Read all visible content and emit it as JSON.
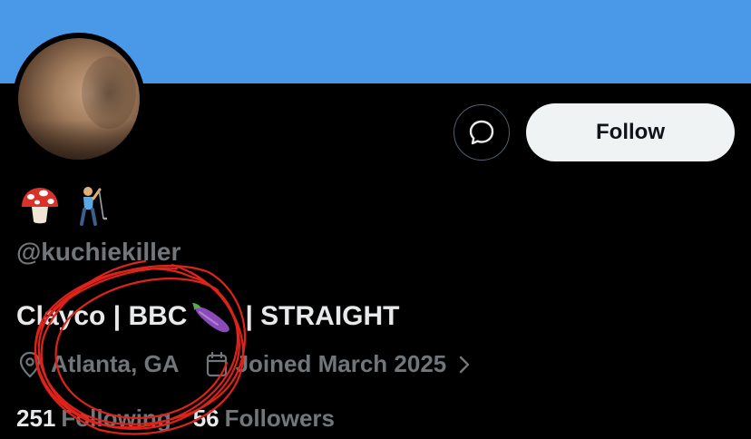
{
  "profile": {
    "handle": "@kuchiekiller",
    "bio_main": "Clayco | BBC",
    "bio_end": " | STRAIGHT",
    "location": "Atlanta, GA",
    "joined": "Joined March 2025",
    "following_count": "251",
    "following_label": "Following",
    "followers_count": "56",
    "followers_label": "Followers",
    "name_emojis": [
      "mushroom-icon",
      "golfer-icon"
    ],
    "bio_emoji": "eggplant-icon"
  },
  "actions": {
    "follow_label": "Follow",
    "message_icon": "message-icon"
  },
  "colors": {
    "banner": "#4a99e9",
    "background": "#000000",
    "follow_bg": "#eff3f4",
    "muted": "#71767b",
    "annotation": "#e0231a"
  }
}
